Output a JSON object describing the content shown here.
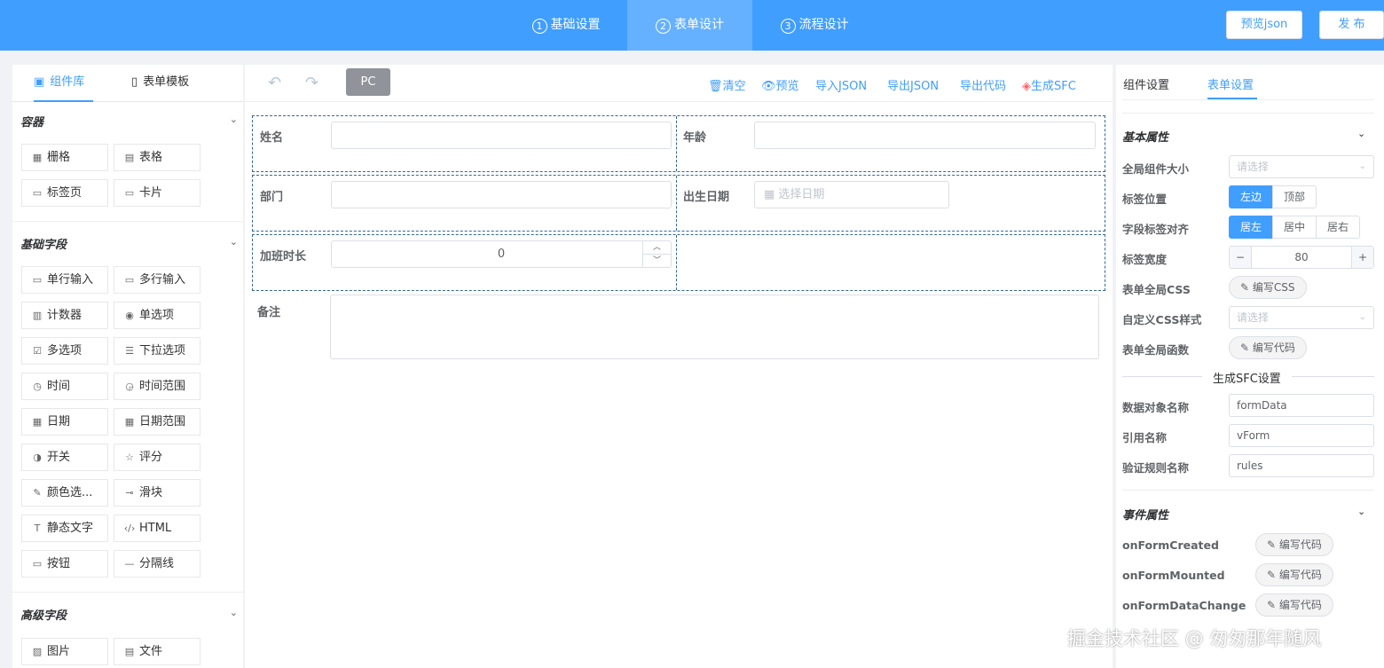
{
  "topbar": {
    "steps": [
      {
        "num": "1",
        "label": "基础设置"
      },
      {
        "num": "2",
        "label": "表单设计"
      },
      {
        "num": "3",
        "label": "流程设计"
      }
    ],
    "preview_json": "预览json",
    "publish": "发 布",
    "accent": "#409eff"
  },
  "left": {
    "tabs": [
      "组件库",
      "表单模板"
    ],
    "groups": {
      "container": {
        "title": "容器",
        "items": [
          "栅格",
          "表格",
          "标签页",
          "卡片"
        ]
      },
      "basic": {
        "title": "基础字段",
        "items": [
          "单行输入",
          "多行输入",
          "计数器",
          "单选项",
          "多选项",
          "下拉选项",
          "时间",
          "时间范围",
          "日期",
          "日期范围",
          "开关",
          "评分",
          "颜色选...",
          "滑块",
          "静态文字",
          "HTML",
          "按钮",
          "分隔线"
        ]
      },
      "advanced": {
        "title": "高级字段",
        "items": [
          "图片",
          "文件"
        ]
      }
    }
  },
  "toolbar": {
    "device": "PC",
    "actions": [
      "清空",
      "预览",
      "导入JSON",
      "导出JSON",
      "导出代码",
      "生成SFC"
    ]
  },
  "form": {
    "fields": {
      "name": "姓名",
      "age": "年龄",
      "dept": "部门",
      "birthday": "出生日期",
      "birthday_placeholder": "选择日期",
      "overtime": "加班时长",
      "overtime_value": "0",
      "remark": "备注"
    }
  },
  "right": {
    "tabs": [
      "组件设置",
      "表单设置"
    ],
    "basic_section": "基本属性",
    "rows": {
      "size_label": "全局组件大小",
      "size_placeholder": "请选择",
      "label_pos": "标签位置",
      "label_pos_opts": [
        "左边",
        "顶部"
      ],
      "label_align": "字段标签对齐",
      "label_align_opts": [
        "居左",
        "居中",
        "居右"
      ],
      "label_width": "标签宽度",
      "label_width_value": "80",
      "form_css": "表单全局CSS",
      "edit_css": "编写CSS",
      "custom_css": "自定义CSS样式",
      "custom_css_placeholder": "请选择",
      "form_func": "表单全局函数",
      "edit_code": "编写代码"
    },
    "sfc_section": "生成SFC设置",
    "sfc": {
      "data_obj_label": "数据对象名称",
      "data_obj_value": "formData",
      "ref_label": "引用名称",
      "ref_value": "vForm",
      "rules_label": "验证规则名称",
      "rules_value": "rules"
    },
    "event_section": "事件属性",
    "events": [
      {
        "name": "onFormCreated",
        "btn": "编写代码"
      },
      {
        "name": "onFormMounted",
        "btn": "编写代码"
      },
      {
        "name": "onFormDataChange",
        "btn": "编写代码"
      }
    ]
  },
  "watermark": "掘金技术社区 @ 匆匆那年随风"
}
